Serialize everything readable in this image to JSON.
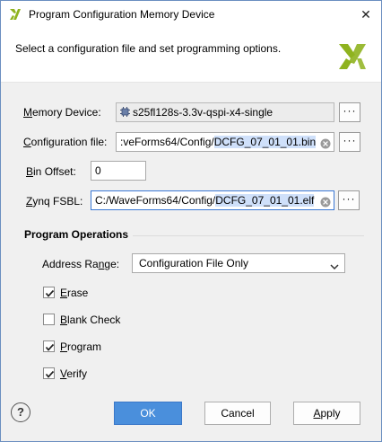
{
  "window": {
    "title": "Program Configuration Memory Device",
    "close_label": "✕"
  },
  "header": {
    "instruction": "Select a configuration file and set programming options."
  },
  "form": {
    "memory_device": {
      "label_prefix": "",
      "label_mnemonic": "M",
      "label_rest": "emory Device:",
      "value": "s25fl128s-3.3v-qspi-x4-single",
      "browse_label": "···"
    },
    "configuration_file": {
      "label_mnemonic": "C",
      "label_rest": "onfiguration file:",
      "value_prefix": ":veForms64/Config/",
      "value_selected": "DCFG_07_01_01.bin",
      "browse_label": "···"
    },
    "bin_offset": {
      "label_mnemonic": "B",
      "label_rest": "in Offset:",
      "value": "0"
    },
    "zynq_fsbl": {
      "label_mnemonic": "Z",
      "label_rest": "ynq FSBL:",
      "value_prefix": "C:/WaveForms64/Config/",
      "value_selected": "DCFG_07_01_01.elf",
      "browse_label": "···"
    }
  },
  "program_operations": {
    "title": "Program Operations",
    "address_range": {
      "label_prefix": "Address Ra",
      "label_mnemonic": "n",
      "label_rest": "ge:",
      "selected": "Configuration File Only"
    },
    "options": [
      {
        "mnemonic": "E",
        "rest": "rase",
        "checked": true
      },
      {
        "mnemonic": "B",
        "rest": "lank Check",
        "checked": false
      },
      {
        "mnemonic": "P",
        "rest": "rogram",
        "checked": true
      },
      {
        "mnemonic": "V",
        "rest": "erify",
        "checked": true
      }
    ]
  },
  "footer": {
    "help_label": "?",
    "ok_label": "OK",
    "cancel_label": "Cancel",
    "apply_prefix": "",
    "apply_mnemonic": "A",
    "apply_rest": "pply"
  },
  "colors": {
    "primary_button": "#4a8fdc",
    "selection": "#cfe0fa",
    "logo_green": "#8fb31f"
  }
}
